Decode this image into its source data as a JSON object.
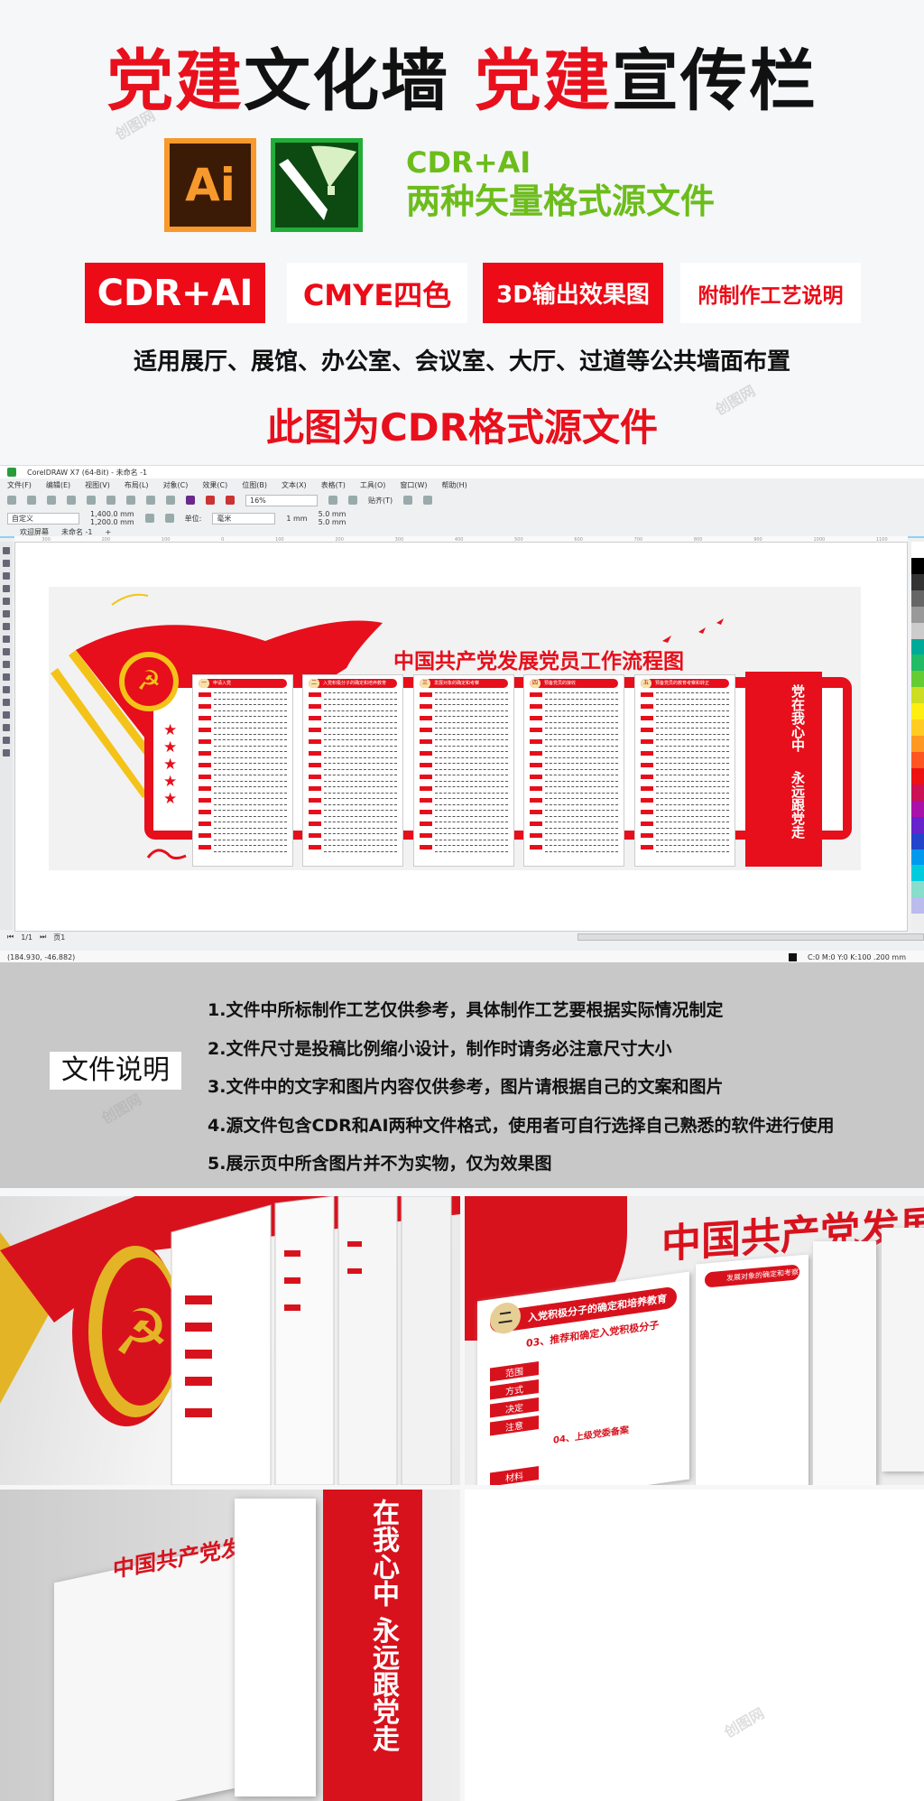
{
  "header": {
    "title_parts": [
      {
        "text": "党建",
        "style": "red"
      },
      {
        "text": "文化墙 ",
        "style": "black"
      },
      {
        "text": "党建",
        "style": "red"
      },
      {
        "text": "宣传栏",
        "style": "black"
      }
    ]
  },
  "logos": {
    "ai_label": "Ai",
    "cdr_icon": "coreldraw-icon",
    "formats_line1": "CDR+AI",
    "formats_line2": "两种矢量格式源文件",
    "format_color": "#6cbd1b"
  },
  "badges": [
    {
      "label": "CDR+AI",
      "style": "red"
    },
    {
      "label": "CMYE四色",
      "style": "white"
    },
    {
      "label": "3D输出效果图",
      "style": "red"
    },
    {
      "label": "附制作工艺说明",
      "style": "white"
    }
  ],
  "usage": "适用展厅、展馆、办公室、会议室、大厅、过道等公共墙面布置",
  "subtitle": "此图为CDR格式源文件",
  "accent": "#e8101c",
  "corel": {
    "window_title": "CorelDRAW X7 (64-Bit) - 未命名 -1",
    "menu": [
      "文件(F)",
      "编辑(E)",
      "视图(V)",
      "布局(L)",
      "对象(C)",
      "效果(C)",
      "位图(B)",
      "文本(X)",
      "表格(T)",
      "工具(O)",
      "窗口(W)",
      "帮助(H)"
    ],
    "zoom": "16%",
    "snap": "贴齐(T)",
    "preset": "自定义",
    "width": "1,400.0 mm",
    "height": "1,200.0 mm",
    "units_label": "单位:",
    "units": "毫米",
    "nudge": "1 mm",
    "dup_x": "5.0 mm",
    "dup_y": "5.0 mm",
    "tabs": [
      "欢迎屏幕",
      "未命名 -1"
    ],
    "ruler": [
      "300",
      "200",
      "100",
      "0",
      "100",
      "200",
      "300",
      "400",
      "500",
      "600",
      "700",
      "800",
      "900",
      "1000",
      "1100"
    ],
    "page_count": "1/1",
    "page_tab": "页1",
    "coords": "(184.930, -46.882)",
    "fill_status": "C:0 M:0 Y:0 K:100 .200 mm",
    "artwork": {
      "title": "中国共产党发展党员工作流程图",
      "panels": [
        {
          "num": "一",
          "title": "申请入党"
        },
        {
          "num": "二",
          "title": "入党积极分子的确定和培养教育"
        },
        {
          "num": "三",
          "title": "发展对象的确定和考察"
        },
        {
          "num": "四",
          "title": "预备党员的接收"
        },
        {
          "num": "五",
          "title": "预备党员的教育考察和转正"
        }
      ],
      "banner_line1": "党在我心中",
      "banner_line2": "永远跟党走"
    }
  },
  "info": {
    "label": "文件说明",
    "items": [
      "1.文件中所标制作工艺仅供参考，具体制作工艺要根据实际情况制定",
      "2.文件尺寸是投稿比例缩小设计，制作时请务必注意尺寸大小",
      "3.文件中的文字和图片内容仅供参考，图片请根据自己的文案和图片",
      "4.源文件包含CDR和AI两种文件格式，使用者可自行选择自己熟悉的软件进行使用",
      "5.展示页中所含图片并不为实物，仅为效果图"
    ]
  },
  "photos": {
    "photo2": {
      "heading": "中国共产党发展党员工",
      "panel_title": "入党积极分子的确定和培养教育",
      "item1": "03、推荐和确定入党积极分子",
      "tags": [
        "范围",
        "方式",
        "决定",
        "注意",
        "材料"
      ],
      "item2": "04、上级党委备案",
      "panel2_title": "发展对象的确定和考察"
    },
    "photo3": {
      "heading": "中国共产党发展党员",
      "banner": "在我心中 永远跟党走"
    }
  },
  "watermark": "创图网"
}
